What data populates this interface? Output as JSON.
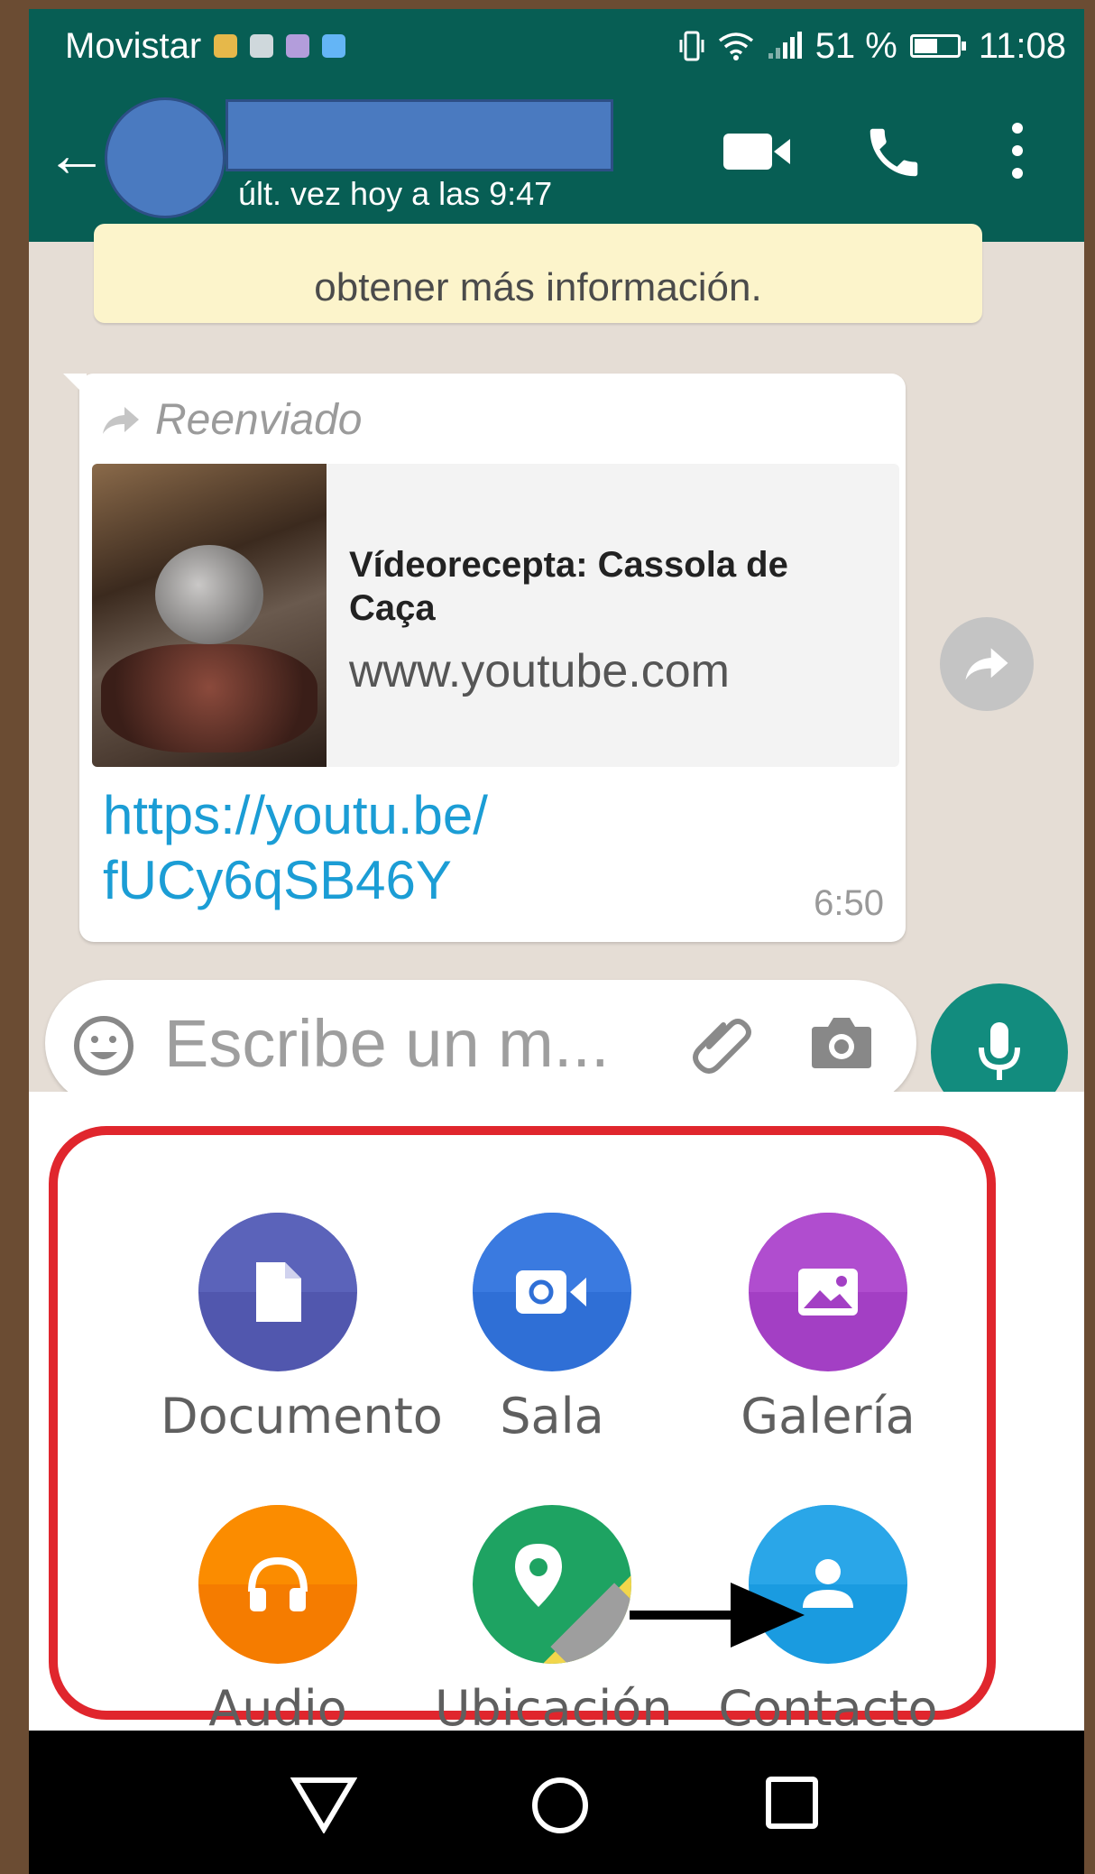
{
  "status_bar": {
    "carrier": "Movistar",
    "notification_colors": [
      "#e6b84a",
      "#cfd8dc",
      "#b39ddb",
      "#64b5f6"
    ],
    "battery": "51 %",
    "time": "11:08"
  },
  "header": {
    "last_seen": "últ. vez hoy a las 9:47"
  },
  "chat": {
    "system_message": "obtener más información.",
    "message": {
      "forwarded_label": "Reenviado",
      "preview_title": "Vídeorecepta: Cassola de Caça",
      "preview_domain": "www.youtube.com",
      "link_line1": "https://youtu.be/",
      "link_line2": "fUCy6qSB46Y",
      "time": "6:50"
    }
  },
  "input": {
    "placeholder": "Escribe un m..."
  },
  "attach_menu": {
    "items": [
      {
        "label": "Documento",
        "icon": "document-icon",
        "color": "#5157ae"
      },
      {
        "label": "Sala",
        "icon": "room-icon",
        "color": "#2f6fd6"
      },
      {
        "label": "Galería",
        "icon": "gallery-icon",
        "color": "#a33fc4"
      },
      {
        "label": "Audio",
        "icon": "headphones-icon",
        "color": "#f57c00"
      },
      {
        "label": "Ubicación",
        "icon": "location-icon",
        "color": "#1ea362"
      },
      {
        "label": "Contacto",
        "icon": "contact-icon",
        "color": "#1a9be0"
      }
    ]
  },
  "colors": {
    "header": "#075e54",
    "accent": "#128c7e",
    "highlight": "#e0262d",
    "link": "#1b9dd5"
  }
}
